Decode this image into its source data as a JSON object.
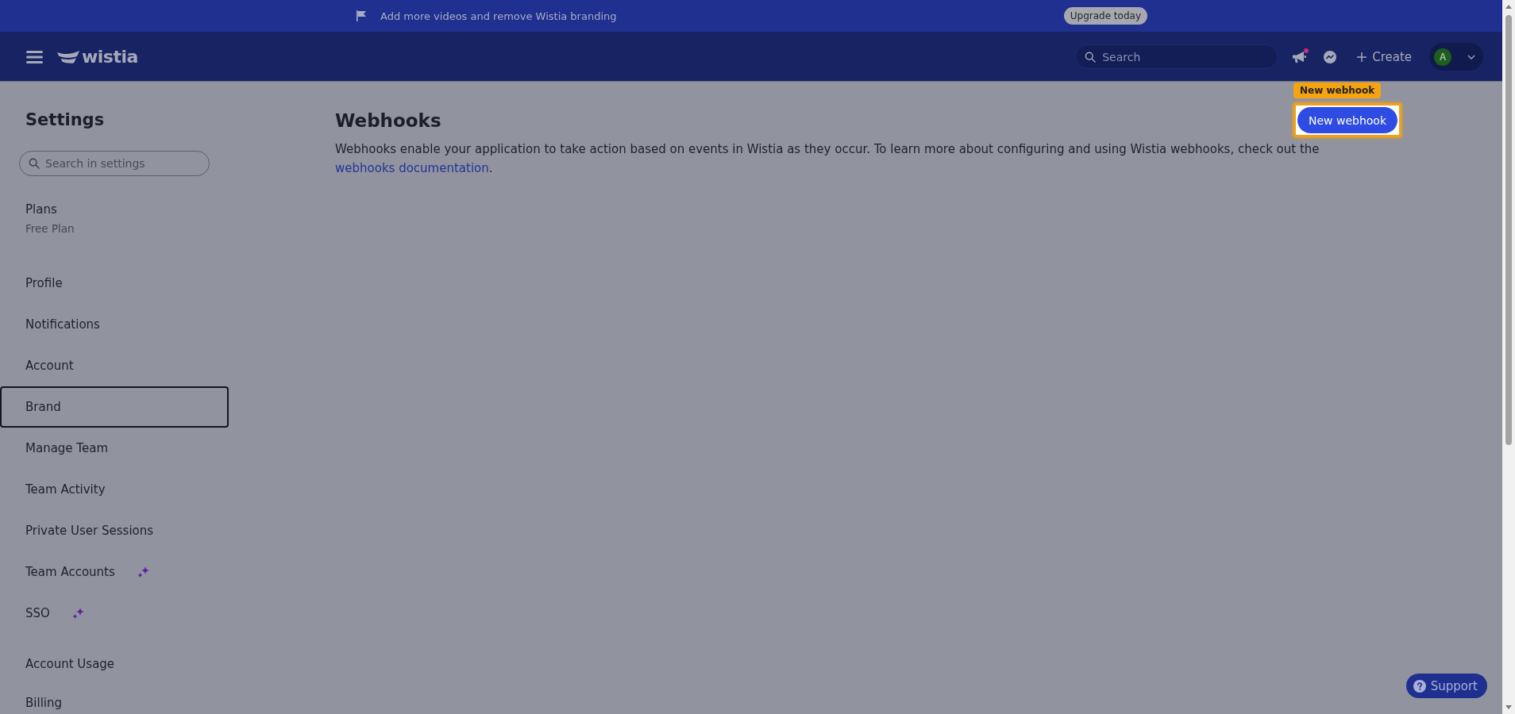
{
  "banner": {
    "message": "Add more videos and remove Wistia branding",
    "button": "Upgrade today"
  },
  "header": {
    "logo": "wistia",
    "search": {
      "placeholder": "Search"
    },
    "announcements": {
      "unread": true
    },
    "create": "Create",
    "avatar": {
      "initial": "A"
    }
  },
  "sidebar": {
    "title": "Settings",
    "search": {
      "placeholder": "Search in settings"
    },
    "groups": [
      {
        "items": [
          {
            "label": "Plans",
            "subtitle": "Free Plan",
            "focused": false,
            "premium": false
          }
        ]
      },
      {
        "items": [
          {
            "label": "Profile",
            "focused": false,
            "premium": false
          },
          {
            "label": "Notifications",
            "focused": false,
            "premium": false
          },
          {
            "label": "Account",
            "focused": false,
            "premium": false
          },
          {
            "label": "Brand",
            "focused": true,
            "premium": false
          },
          {
            "label": "Manage Team",
            "focused": false,
            "premium": false
          },
          {
            "label": "Team Activity",
            "focused": false,
            "premium": false
          },
          {
            "label": "Private User Sessions",
            "focused": false,
            "premium": false
          },
          {
            "label": "Team Accounts",
            "focused": false,
            "premium": true
          },
          {
            "label": "SSO",
            "focused": false,
            "premium": true
          }
        ]
      },
      {
        "items": [
          {
            "label": "Account Usage",
            "focused": false,
            "premium": false
          },
          {
            "label": "Billing",
            "focused": false,
            "premium": false
          }
        ]
      }
    ]
  },
  "content": {
    "title": "Webhooks",
    "description": "Webhooks enable your application to take action based on events in Wistia as they occur. To learn more about configuring and using Wistia webhooks, check out the",
    "link": "webhooks documentation",
    "after_link": ".",
    "button": {
      "label": "New webhook",
      "highlighted": true
    }
  },
  "guide": {
    "tag": "New webhook"
  },
  "support": {
    "label": "Support"
  }
}
